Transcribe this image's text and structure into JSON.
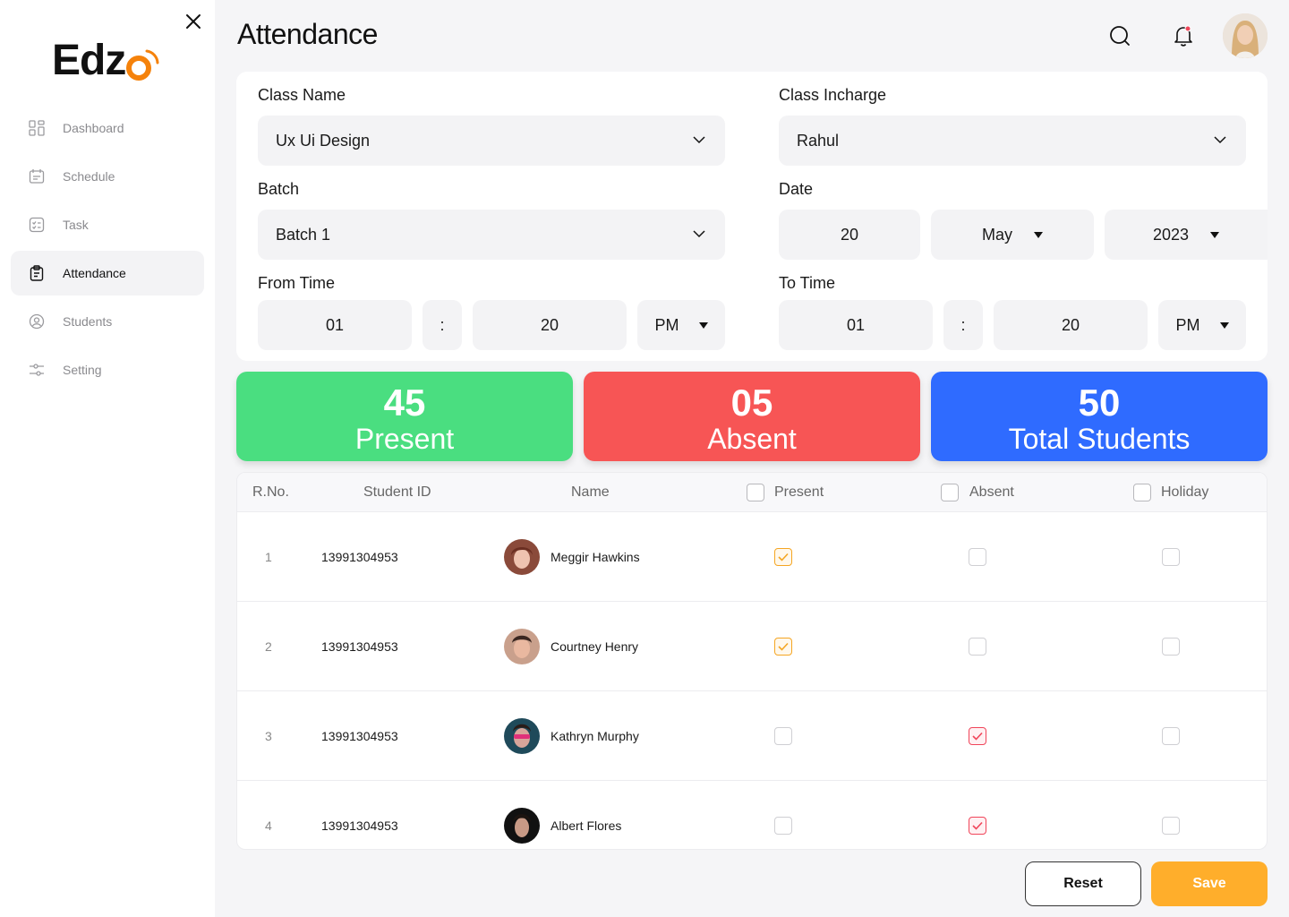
{
  "app": {
    "logo": "Edz"
  },
  "sidebar": {
    "items": [
      {
        "label": "Dashboard",
        "icon": "grid-icon"
      },
      {
        "label": "Schedule",
        "icon": "calendar-icon"
      },
      {
        "label": "Task",
        "icon": "task-icon"
      },
      {
        "label": "Attendance",
        "icon": "clipboard-icon",
        "active": true
      },
      {
        "label": "Students",
        "icon": "user-icon"
      },
      {
        "label": "Setting",
        "icon": "sliders-icon"
      }
    ]
  },
  "header": {
    "title": "Attendance"
  },
  "form": {
    "class_name": {
      "label": "Class Name",
      "value": "Ux Ui Design"
    },
    "class_incharge": {
      "label": "Class Incharge",
      "value": "Rahul"
    },
    "batch": {
      "label": "Batch",
      "value": "Batch 1"
    },
    "date": {
      "label": "Date",
      "day": "20",
      "month": "May",
      "year": "2023"
    },
    "from_time": {
      "label": "From Time",
      "hour": "01",
      "sep": ":",
      "minute": "20",
      "period": "PM"
    },
    "to_time": {
      "label": "To Time",
      "hour": "01",
      "sep": ":",
      "minute": "20",
      "period": "PM"
    }
  },
  "stats": {
    "present": {
      "count": "45",
      "label": "Present",
      "color": "#4ade80"
    },
    "absent": {
      "count": "05",
      "label": "Absent",
      "color": "#f75555"
    },
    "total": {
      "count": "50",
      "label": "Total Students",
      "color": "#2f6bff"
    }
  },
  "table": {
    "headers": {
      "rno": "R.No.",
      "student_id": "Student ID",
      "name": "Name",
      "present": "Present",
      "absent": "Absent",
      "holiday": "Holiday"
    },
    "rows": [
      {
        "rno": "1",
        "student_id": "13991304953",
        "name": "Meggir Hawkins",
        "status": "present"
      },
      {
        "rno": "2",
        "student_id": "13991304953",
        "name": "Courtney Henry",
        "status": "present"
      },
      {
        "rno": "3",
        "student_id": "13991304953",
        "name": "Kathryn Murphy",
        "status": "absent"
      },
      {
        "rno": "4",
        "student_id": "13991304953",
        "name": "Albert Flores",
        "status": "absent"
      }
    ]
  },
  "actions": {
    "reset": "Reset",
    "save": "Save"
  },
  "colors": {
    "accent": "#ffae2b",
    "logo_o": "#f5820b",
    "check_present": "#f5a623",
    "check_absent": "#f0455a"
  }
}
